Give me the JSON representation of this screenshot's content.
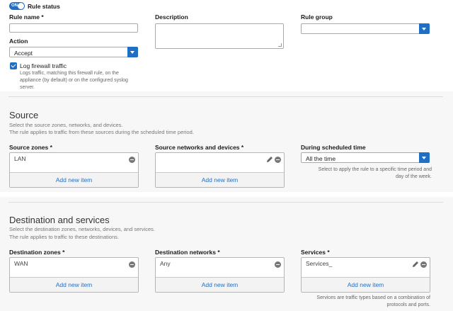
{
  "rule": {
    "status_toggle": "ON",
    "status_label": "Rule status",
    "name_label": "Rule name *",
    "name_value": "",
    "description_label": "Description",
    "description_value": "",
    "group_label": "Rule group",
    "group_value": "",
    "action_label": "Action",
    "action_value": "Accept",
    "log_label": "Log firewall traffic",
    "log_checked": true,
    "log_help": "Logs traffic, matching this firewall rule, on the appliance (by default) or on the configured syslog server."
  },
  "source": {
    "title": "Source",
    "desc1": "Select the source zones, networks, and devices.",
    "desc2": "The rule applies to traffic from these sources during the scheduled time period.",
    "zones_label": "Source zones *",
    "zones_items": [
      "LAN"
    ],
    "networks_label": "Source networks and devices *",
    "networks_items": [
      ""
    ],
    "schedule_label": "During scheduled time",
    "schedule_value": "All the time",
    "schedule_help": "Select to apply the rule to a specific time period and day of the week.",
    "add_item": "Add new item"
  },
  "destination": {
    "title": "Destination and services",
    "desc1": "Select the destination zones, networks, devices, and services.",
    "desc2": "The rule applies to traffic to these destinations.",
    "zones_label": "Destination zones *",
    "zones_items": [
      "WAN"
    ],
    "networks_label": "Destination networks *",
    "networks_items": [
      "Any"
    ],
    "services_label": "Services *",
    "services_items": [
      "Services_"
    ],
    "services_help": "Services are traffic types based on a combination of protocols and ports.",
    "add_item": "Add new item"
  },
  "colors": {
    "accent": "#1f6fc5",
    "section_bg": "#f7f7f7"
  }
}
